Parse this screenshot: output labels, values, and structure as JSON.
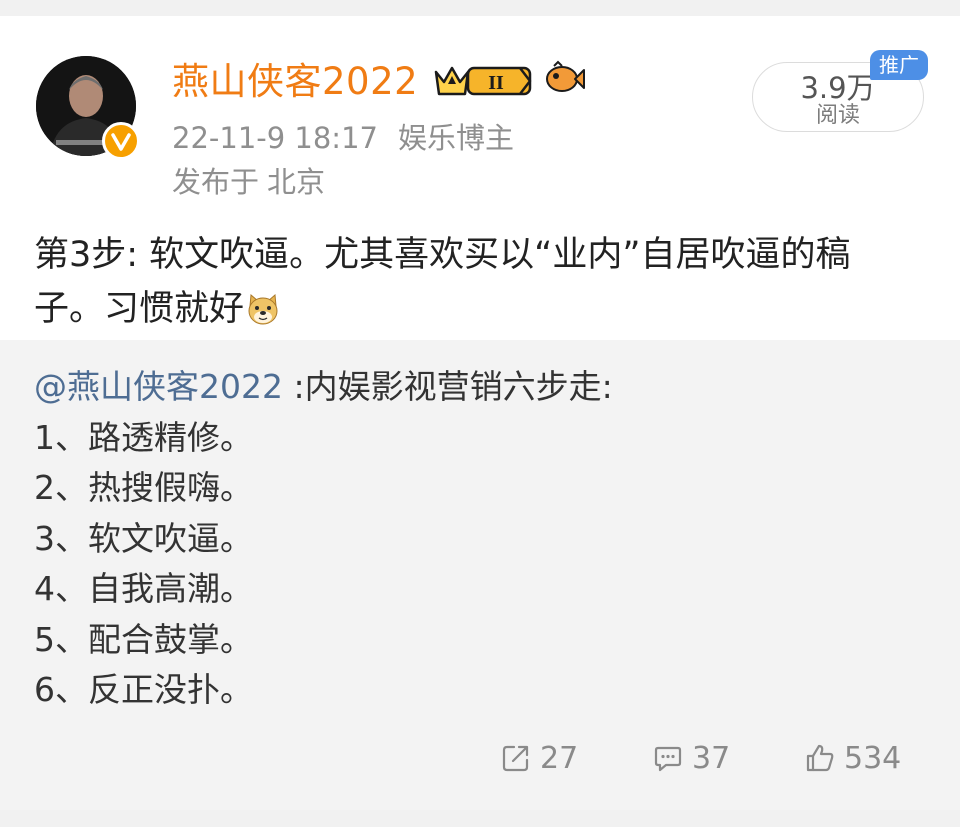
{
  "header": {
    "username": "燕山侠客2022",
    "timestamp": "22-11-9 18:17",
    "category": "娱乐博主",
    "location_prefix": "发布于",
    "location": "北京",
    "avatar_icon": "person-avatar",
    "verified_icon": "verified-v-badge-icon",
    "crown_icon": "vip-crown-level-badge-icon",
    "crown_level": "II",
    "fish_icon": "fish-badge-icon",
    "username_color": "#f07c14"
  },
  "stats": {
    "read_count": "3.9万",
    "read_label": "阅读",
    "promo_tag": "推广",
    "promo_color": "#4d8fe6"
  },
  "post": {
    "text": "第3步: 软文吹逼。尤其喜欢买以“业内”自居吹逼的稿子。习惯就好",
    "emoji": "doge-emoji"
  },
  "quoted": {
    "mention": "@燕山侠客2022",
    "intro": " :内娱影视营销六步走:",
    "items": [
      "1、路透精修。",
      "2、热搜假嗨。",
      "3、软文吹逼。",
      "4、自我高潮。",
      "5、配合鼓掌。",
      "6、反正没扑。"
    ]
  },
  "actions": {
    "repost_count": "27",
    "comment_count": "37",
    "like_count": "534",
    "repost_icon": "repost-icon",
    "comment_icon": "comment-icon",
    "like_icon": "thumbs-up-icon"
  }
}
